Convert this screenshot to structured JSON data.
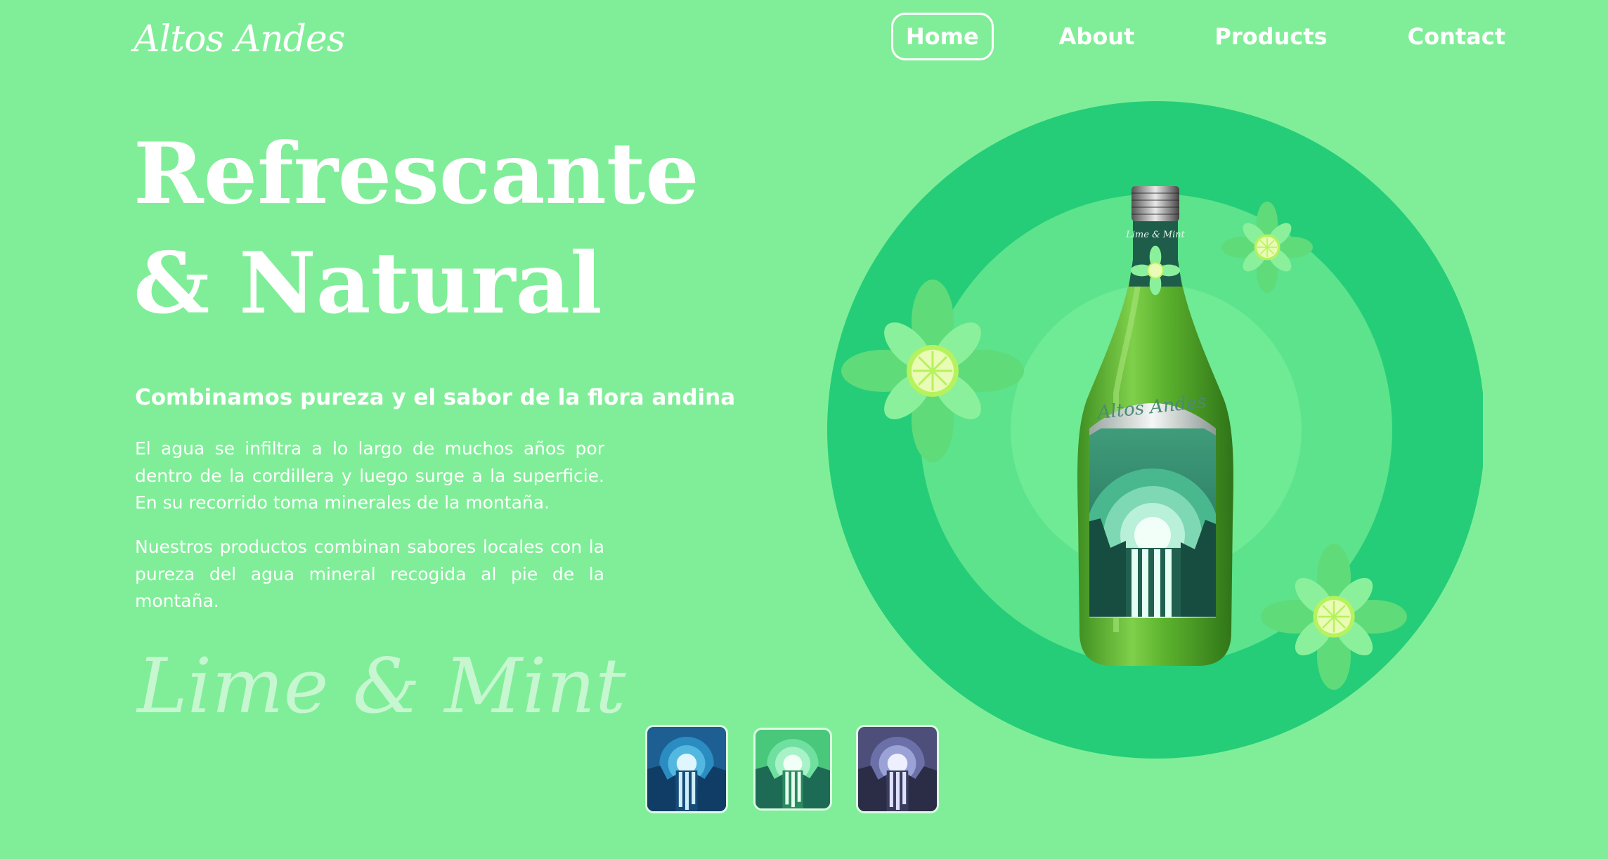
{
  "brand": "Altos Andes",
  "nav": {
    "items": [
      "Home",
      "About",
      "Products",
      "Contact"
    ],
    "active": "Home"
  },
  "hero": {
    "title_line1": "Refrescante",
    "title_line2": "& Natural",
    "subtitle": "Combinamos pureza y el sabor de la flora andina",
    "paragraph1": "El agua se infiltra a lo largo de muchos años por dentro de la cordillera y luego surge a la superficie. En su recorrido toma minerales de la montaña.",
    "paragraph2": "Nuestros productos combinan sabores locales con la pureza del agua mineral recogida al pie de la montaña.",
    "flavor": "Lime & Mint"
  },
  "bottle": {
    "brand_label": "Altos Andes",
    "neck_label": "Lime & Mint"
  },
  "thumbnails": [
    {
      "name": "night-blue",
      "color": "#1f6fa0"
    },
    {
      "name": "lime-mint",
      "color": "#49c77a"
    },
    {
      "name": "dusk-purple",
      "color": "#5a5f8f"
    }
  ],
  "colors": {
    "background": "#80ee98",
    "ring_outer": "#25cd78",
    "ring_mid": "#5ce38c",
    "ring_inner": "#6fea95",
    "bottle_glass": "#54a52b"
  }
}
